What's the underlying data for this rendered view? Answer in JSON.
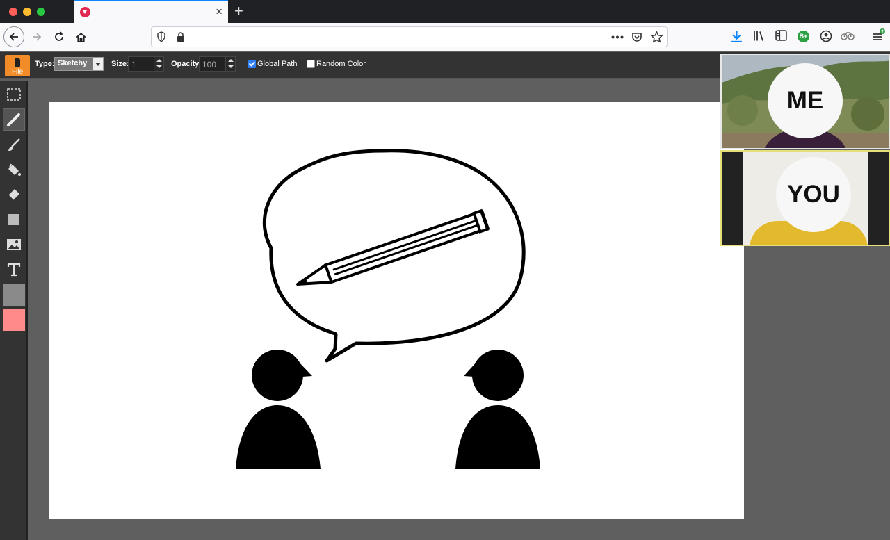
{
  "browser": {
    "tab_close": "×",
    "new_tab": "+"
  },
  "toolbar": {
    "file_label": "File",
    "type_label": "Type:",
    "type_value": "Sketchy",
    "size_label": "Size:",
    "size_value": "1",
    "opacity_label": "Opacity:",
    "opacity_value": "100",
    "global_path_label": "Global Path",
    "global_path_checked": true,
    "random_color_label": "Random Color",
    "random_color_checked": false
  },
  "tools": [
    {
      "name": "select-tool",
      "icon": "marquee-icon"
    },
    {
      "name": "pencil-tool",
      "icon": "pencil-icon",
      "active": true
    },
    {
      "name": "brush-tool",
      "icon": "brush-icon"
    },
    {
      "name": "fill-tool",
      "icon": "paint-bucket-icon"
    },
    {
      "name": "eraser-tool",
      "icon": "eraser-icon"
    },
    {
      "name": "rectangle-tool",
      "icon": "rectangle-icon"
    },
    {
      "name": "image-tool",
      "icon": "image-icon"
    },
    {
      "name": "text-tool",
      "icon": "text-icon"
    }
  ],
  "colors": {
    "primary": "#8a8a8a",
    "secondary": "#ff8a8a",
    "file_button": "#f28c28"
  },
  "video": {
    "me_label": "ME",
    "you_label": "YOU"
  }
}
